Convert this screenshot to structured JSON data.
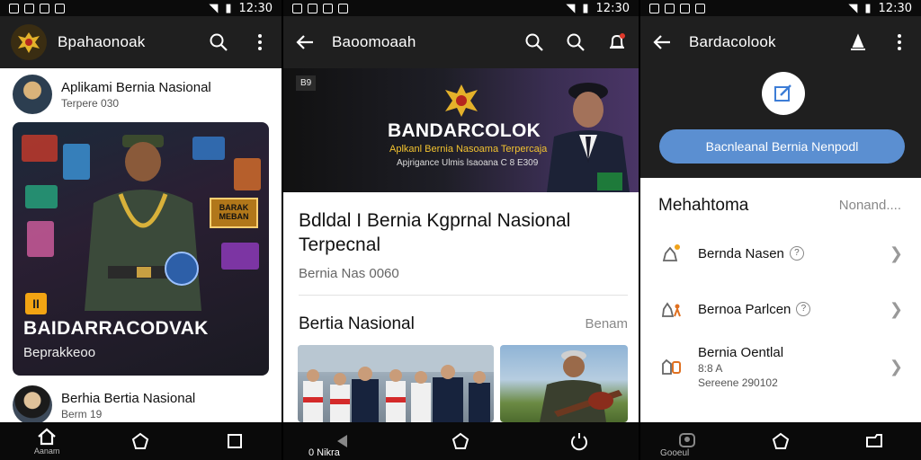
{
  "status": {
    "time": "12:30"
  },
  "phone1": {
    "app_title": "Bpahaonoak",
    "post1": {
      "name": "Aplikami Bernia Nasional",
      "sub": "Terpere 030"
    },
    "hero": {
      "badge": "II",
      "sign": "BARAK MEBAN",
      "title": "BAIDARRACODVAK",
      "sub": "Beprakkeoo"
    },
    "post2": {
      "name": "Berhia Bertia Nasional",
      "sub": "Berm 19"
    },
    "nav": {
      "home_label": "Aanam"
    }
  },
  "phone2": {
    "app_title": "Baoomoaah",
    "banner": {
      "tag": "B9",
      "title": "BANDARCOLOK",
      "sub1": "Aplkanl Bernia Nasoama Terpercaja",
      "sub2": "Apjrigance Ulmis lsaoana C 8 E309"
    },
    "article": {
      "title": "Bdldal I Bernia Kgprnal Nasional Terpecnal",
      "sub": "Bernia Nas 0060"
    },
    "section": {
      "title": "Bertia Nasional",
      "more": "Benam"
    },
    "nav": {
      "label": "0 Nikra"
    }
  },
  "phone3": {
    "app_title": "Bardacolook",
    "pill": "Bacnleanal Bernia Nenpodl",
    "list": {
      "title": "Mehahtoma",
      "more": "Nonand....",
      "items": [
        {
          "label": "Bernda Nasen",
          "desc": ""
        },
        {
          "label": "Bernoa Parlcen",
          "desc": ""
        },
        {
          "label": "Bernia Oentlal",
          "desc": "8:8 A",
          "desc2": "Sereene 290102"
        }
      ]
    },
    "nav": {
      "label": "Gooeul"
    }
  }
}
